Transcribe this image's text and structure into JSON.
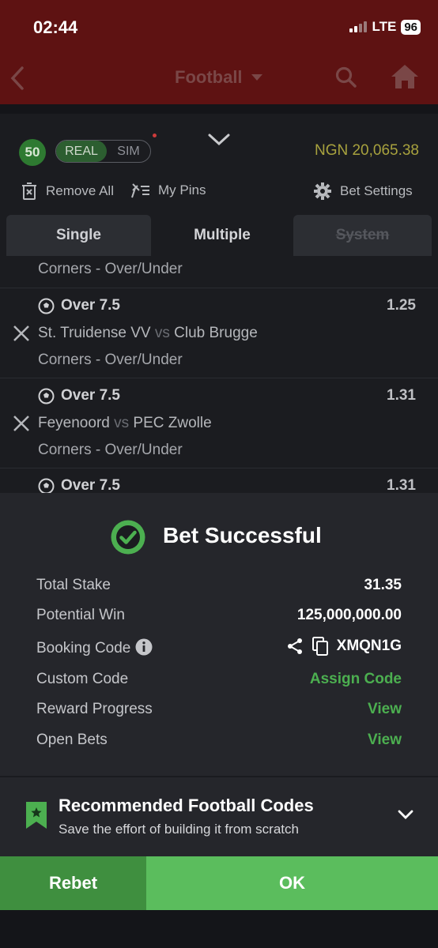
{
  "status_bar": {
    "time": "02:44",
    "network": "LTE",
    "battery": "96"
  },
  "header": {
    "title": "Football"
  },
  "betslip": {
    "count": "50",
    "mode_real": "REAL",
    "mode_sim": "SIM",
    "balance": "NGN 20,065.38",
    "remove_all": "Remove All",
    "my_pins": "My Pins",
    "bet_settings": "Bet Settings",
    "tabs": [
      {
        "label": "Single"
      },
      {
        "label": "Multiple"
      },
      {
        "label": "System"
      }
    ],
    "top_market": "Corners - Over/Under",
    "bets": [
      {
        "selection": "Over 7.5",
        "odds": "1.25",
        "home": "St. Truidense VV",
        "vs": "vs",
        "away": "Club Brugge",
        "market": "Corners - Over/Under"
      },
      {
        "selection": "Over 7.5",
        "odds": "1.31",
        "home": "Feyenoord",
        "vs": "vs",
        "away": "PEC Zwolle",
        "market": "Corners - Over/Under"
      },
      {
        "selection": "Over 7.5",
        "odds": "1.31"
      }
    ]
  },
  "success": {
    "title": "Bet Successful",
    "total_stake_label": "Total Stake",
    "total_stake": "31.35",
    "potential_win_label": "Potential Win",
    "potential_win": "125,000,000.00",
    "booking_code_label": "Booking Code",
    "booking_code": "XMQN1G",
    "custom_code_label": "Custom Code",
    "custom_code_action": "Assign Code",
    "reward_progress_label": "Reward Progress",
    "reward_progress_action": "View",
    "open_bets_label": "Open Bets",
    "open_bets_action": "View"
  },
  "recommended": {
    "title": "Recommended Football Codes",
    "subtitle": "Save the effort of building it from scratch"
  },
  "buttons": {
    "rebet": "Rebet",
    "ok": "OK"
  },
  "colors": {
    "accent_green": "#4caf50",
    "ok_green": "#5bbd5d",
    "rebet_green": "#3f8f3f",
    "header_red": "#5e1212"
  }
}
